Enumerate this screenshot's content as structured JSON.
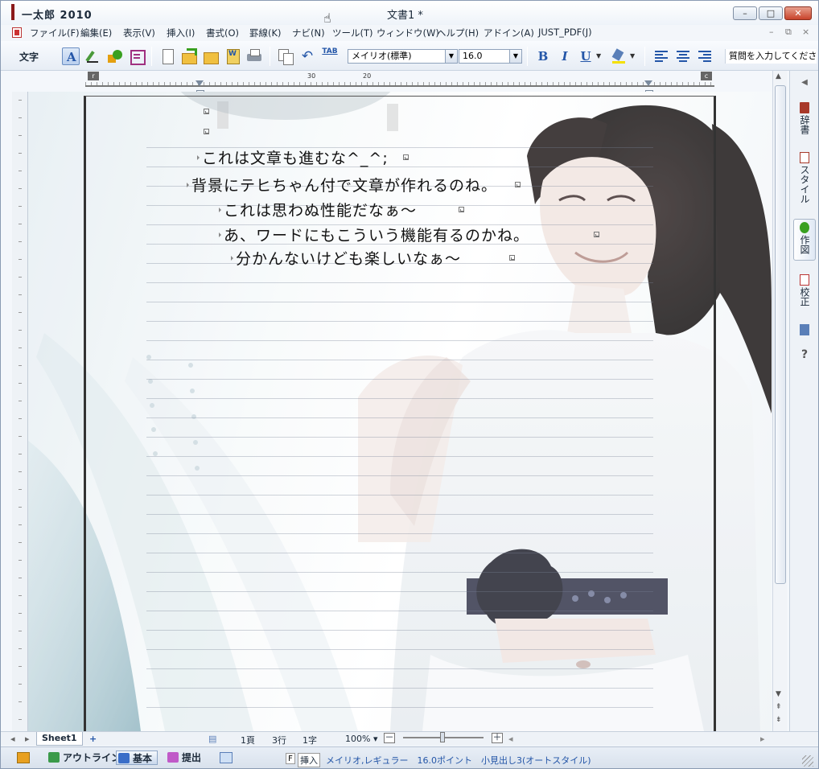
{
  "window": {
    "app_title": "一太郎 2010",
    "doc_title": "文書1 *",
    "min_label": "–",
    "max_label": "□",
    "close_label": "✕"
  },
  "menu": [
    "ファイル(F)",
    "編集(E)",
    "表示(V)",
    "挿入(I)",
    "書式(O)",
    "罫線(K)",
    "ナビ(N)",
    "ツール(T)",
    "ウィンドウ(W)",
    "ヘルプ(H)",
    "アドイン(A)",
    "JUST_PDF(J)"
  ],
  "mdi": {
    "min": "–",
    "restore": "⧉",
    "close": "×"
  },
  "toolbar": {
    "mode_label": "文字",
    "font_name": "メイリオ(標準)",
    "font_size": "16.0",
    "tab_label": "TAB",
    "bold": "B",
    "italic": "I",
    "underline": "U",
    "help_placeholder": "質問を入力してください"
  },
  "ruler": {
    "marks": [
      "30",
      "20"
    ],
    "left_marker": "r",
    "right_marker": "c"
  },
  "document": {
    "paragraphs": [
      "これは文章も進むな^_^;",
      "背景にテヒちゃん付で文章が作れるのね。",
      "これは思わぬ性能だなぁ～",
      "あ、ワードにもこういう機能有るのかね。",
      "分かんないけども楽しいなぁ～"
    ]
  },
  "side_panel": {
    "dict": "辞書",
    "style": "スタイル",
    "draw": "作図",
    "proof": "校正",
    "help": "?"
  },
  "sheet": {
    "tab": "Sheet1",
    "add": "+"
  },
  "status": {
    "page": "1頁",
    "row": "3行",
    "col": "1字",
    "zoom": "100% ▾",
    "zoom_out": "－",
    "zoom_in": "＋",
    "modes": [
      "アウトライン",
      "基本",
      "提出"
    ],
    "key_f": "F",
    "insert": "挿入",
    "font_info": "メイリオ,レギュラー　16.0ポイント　小見出し3(オートスタイル)"
  }
}
